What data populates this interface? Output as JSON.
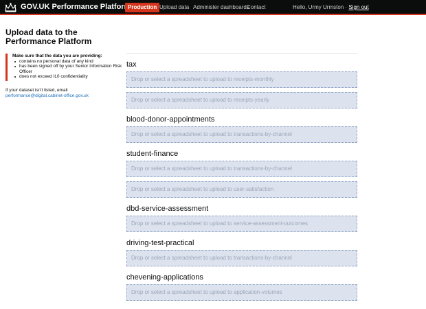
{
  "header": {
    "brand": "GOV.UK Performance Platform admin",
    "environment": "Production",
    "nav": {
      "upload": "Upload data",
      "administer": "Administer dashboards",
      "contact": "Contact"
    },
    "user_greeting": "Hello, Urmy Urmston ·",
    "sign_out": "Sign out",
    "logo_icon": "crown-icon"
  },
  "page": {
    "title": "Upload data to the Performance Platform"
  },
  "notice": {
    "heading": "Make sure that the data you are providing:",
    "items": [
      "contains no personal data of any kind",
      "has been signed off by your Senior Information Risk Officer",
      "does not exceed IL0 confidentiality"
    ]
  },
  "help": {
    "text": "If your dataset isn't listed, email",
    "email": "performance@digital.cabinet-office.gov.uk"
  },
  "groups": [
    {
      "title": "tax",
      "dropzones": [
        "Drop or select a spreadsheet to upload to receipts-monthly",
        "Drop or select a spreadsheet to upload to receipts-yearly"
      ]
    },
    {
      "title": "blood-donor-appointments",
      "dropzones": [
        "Drop or select a spreadsheet to upload to transactions-by-channel"
      ]
    },
    {
      "title": "student-finance",
      "dropzones": [
        "Drop or select a spreadsheet to upload to transactions-by-channel",
        "Drop or select a spreadsheet to upload to user-satisfaction"
      ]
    },
    {
      "title": "dbd-service-assessment",
      "dropzones": [
        "Drop or select a spreadsheet to upload to service-assessment-outcomes"
      ]
    },
    {
      "title": "driving-test-practical",
      "dropzones": [
        "Drop or select a spreadsheet to upload to transactions-by-channel"
      ]
    },
    {
      "title": "chevening-applications",
      "dropzones": [
        "Drop or select a spreadsheet to upload to application-volumes"
      ]
    }
  ],
  "colors": {
    "header_bg": "#0b0c0c",
    "accent_red": "#d4351c",
    "dropzone_bg": "#dde3ee",
    "dropzone_border": "#8ea2c4",
    "link_blue": "#1d70b8"
  }
}
